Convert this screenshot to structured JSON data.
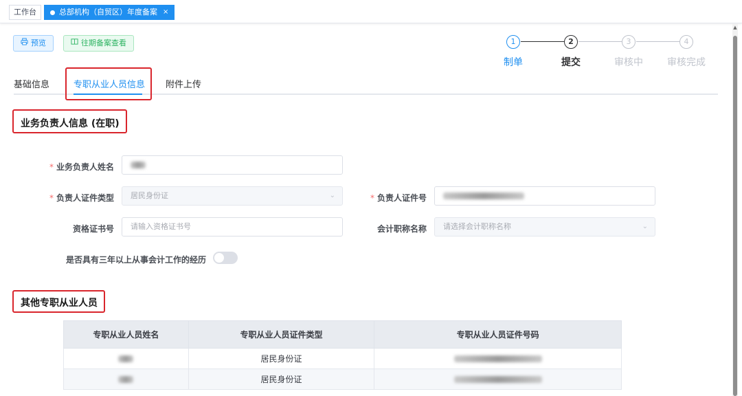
{
  "tabs": {
    "home": "工作台",
    "active": "总部机构（自贸区）年度备案",
    "close": "×"
  },
  "toolbar": {
    "preview_icon": "printer-icon",
    "preview": "预览",
    "history_icon": "book-icon",
    "history": "往期备案查看"
  },
  "steps": [
    {
      "num": "1",
      "label": "制单",
      "state": "current"
    },
    {
      "num": "2",
      "label": "提交",
      "state": "active"
    },
    {
      "num": "3",
      "label": "审核中",
      "state": "pending"
    },
    {
      "num": "4",
      "label": "审核完成",
      "state": "pending"
    }
  ],
  "subtabs": [
    "基础信息",
    "专职从业人员信息",
    "附件上传"
  ],
  "section1": {
    "title": "业务负责人信息 (在职)"
  },
  "form": {
    "name_label": "业务负责人姓名",
    "id_type_label": "负责人证件类型",
    "id_type_value": "居民身份证",
    "id_no_label": "负责人证件号",
    "cert_label": "资格证书号",
    "cert_placeholder": "请输入资格证书号",
    "title_label": "会计职称名称",
    "title_placeholder": "请选择会计职称名称",
    "experience_label": "是否具有三年以上从事会计工作的经历"
  },
  "section2": {
    "title": "其他专职从业人员"
  },
  "table": {
    "headers": [
      "专职从业人员姓名",
      "专职从业人员证件类型",
      "专职从业人员证件号码"
    ],
    "rows": [
      {
        "type": "居民身份证"
      },
      {
        "type": "居民身份证"
      }
    ]
  },
  "colors": {
    "primary": "#1f8ff0",
    "highlight_box": "#d9252c",
    "success": "#2fb463"
  }
}
